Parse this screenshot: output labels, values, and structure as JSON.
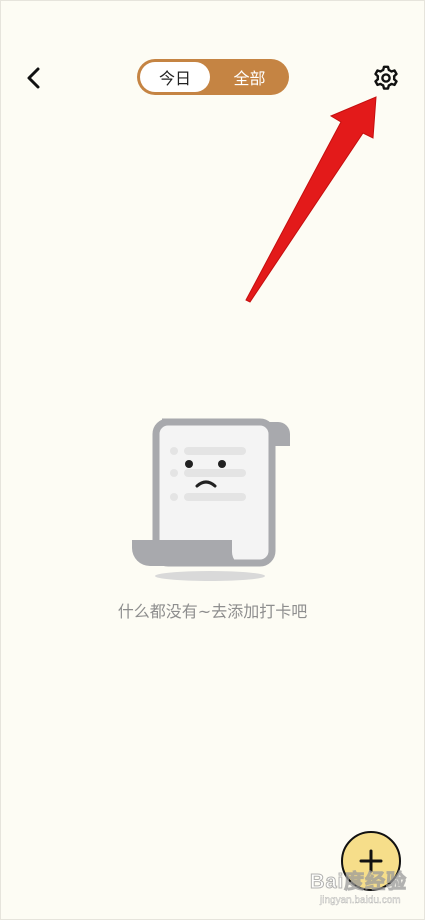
{
  "header": {
    "back_icon": "chevron-left-icon",
    "tabs": [
      {
        "label": "今日",
        "active": true
      },
      {
        "label": "全部",
        "active": false
      }
    ],
    "settings_icon": "gear-icon"
  },
  "empty_state": {
    "illustration": "sad-scroll-illustration",
    "message": "什么都没有~去添加打卡吧"
  },
  "fab": {
    "icon": "plus-icon"
  },
  "watermark": {
    "text": "Bai度经验",
    "url": "jingyan.baidu.com"
  },
  "colors": {
    "background": "#fdfcf4",
    "accent": "#c58443",
    "fab": "#f6de8a",
    "annotation_arrow": "#e31a1a",
    "muted_text": "#8e8e8e"
  }
}
